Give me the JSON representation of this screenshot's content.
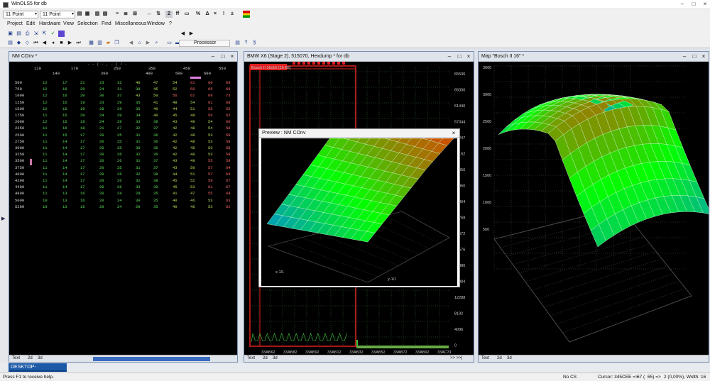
{
  "window": {
    "title": "WinOLS5 for db"
  },
  "toolbar": {
    "font_size_1": "11 Point",
    "font_size_2": "11 Point"
  },
  "menu": {
    "items": [
      "Project",
      "Edit",
      "Hardware",
      "View",
      "Selection",
      "Find",
      "Miscellaneous",
      "Window",
      "?"
    ]
  },
  "toolbar3": {
    "processor_label": "Processor"
  },
  "table_window": {
    "title": "NM COnv *",
    "header_mark": "- - ( - , - ) / -",
    "col_headers_top": [
      "110",
      "170",
      "250",
      "350",
      "450",
      "550"
    ],
    "col_headers_bottom": [
      "140",
      "200",
      "400",
      "500",
      "600"
    ],
    "row_headers": [
      "500",
      "750",
      "1000",
      "1250",
      "1500",
      "1750",
      "2000",
      "2250",
      "2500",
      "2750",
      "3000",
      "3250",
      "3500",
      "3750",
      "4000",
      "4200",
      "4400",
      "4800",
      "5000",
      "5200"
    ],
    "rows": [
      [
        "12",
        "17",
        "21",
        "23",
        "32",
        "40",
        "47",
        "54",
        "61",
        "60",
        "69",
        "72"
      ],
      [
        "12",
        "16",
        "20",
        "24",
        "31",
        "38",
        "45",
        "52",
        "59",
        "65",
        "69",
        "72"
      ],
      [
        "12",
        "16",
        "20",
        "30",
        "37",
        "43",
        "50",
        "56",
        "62",
        "69",
        "73",
        "74"
      ],
      [
        "12",
        "16",
        "19",
        "23",
        "29",
        "35",
        "41",
        "48",
        "54",
        "61",
        "68",
        "72"
      ],
      [
        "12",
        "16",
        "19",
        "28",
        "29",
        "35",
        "40",
        "44",
        "51",
        "55",
        "65",
        "72"
      ],
      [
        "11",
        "15",
        "20",
        "24",
        "29",
        "34",
        "40",
        "45",
        "49",
        "56",
        "62",
        "71"
      ],
      [
        "12",
        "16",
        "19",
        "24",
        "29",
        "33",
        "38",
        "43",
        "49",
        "54",
        "60",
        "69"
      ],
      [
        "11",
        "16",
        "18",
        "21",
        "27",
        "32",
        "37",
        "42",
        "48",
        "54",
        "58",
        "68"
      ],
      [
        "11",
        "15",
        "17",
        "20",
        "25",
        "31",
        "36",
        "42",
        "48",
        "53",
        "59",
        "67"
      ],
      [
        "11",
        "14",
        "17",
        "20",
        "25",
        "31",
        "36",
        "42",
        "48",
        "53",
        "58",
        "67"
      ],
      [
        "11",
        "14",
        "17",
        "20",
        "25",
        "30",
        "36",
        "42",
        "48",
        "53",
        "58",
        "67"
      ],
      [
        "11",
        "14",
        "17",
        "20",
        "26",
        "32",
        "36",
        "42",
        "48",
        "53",
        "58",
        "67"
      ],
      [
        "11",
        "14",
        "17",
        "20",
        "26",
        "31",
        "37",
        "43",
        "49",
        "55",
        "59",
        "67"
      ],
      [
        "11",
        "14",
        "17",
        "20",
        "25",
        "31",
        "37",
        "43",
        "50",
        "57",
        "64",
        "69"
      ],
      [
        "11",
        "14",
        "17",
        "20",
        "26",
        "32",
        "38",
        "44",
        "51",
        "57",
        "64",
        "69"
      ],
      [
        "11",
        "14",
        "17",
        "20",
        "26",
        "32",
        "38",
        "45",
        "52",
        "59",
        "67",
        "69"
      ],
      [
        "11",
        "14",
        "17",
        "20",
        "26",
        "33",
        "39",
        "45",
        "53",
        "61",
        "67",
        "69"
      ],
      [
        "11",
        "13",
        "16",
        "20",
        "24",
        "29",
        "35",
        "41",
        "47",
        "55",
        "64",
        "69"
      ],
      [
        "10",
        "13",
        "16",
        "20",
        "24",
        "30",
        "35",
        "40",
        "46",
        "53",
        "63",
        "69"
      ],
      [
        "10",
        "13",
        "16",
        "20",
        "24",
        "29",
        "35",
        "40",
        "46",
        "53",
        "62",
        "69"
      ]
    ],
    "tabs": [
      "Text",
      "2d",
      "3d"
    ]
  },
  "hex_window": {
    "title": "BMW X6 (Stage 2), 515070, Hexdump * for db",
    "map_label": "Bosch II 16x16 (16 Bit)",
    "right_axis": [
      "65536",
      "65000",
      "61440",
      "57344",
      "53247",
      "49152",
      "45056",
      "40960",
      "36864",
      "32768",
      "28672",
      "24576",
      "20480",
      "16384",
      "12288",
      "8192",
      "4096",
      "0"
    ],
    "address_labels": [
      "33AB62",
      "33AB82",
      "33AB92",
      "33AB12",
      "33AB32",
      "33AB52",
      "33AB72",
      "33AB92",
      "33AC31"
    ],
    "tabs": [
      "Text",
      "2d",
      "3d"
    ],
    "arrows": ">> >>|"
  },
  "preview_window": {
    "title": "Preview : NM COnv",
    "axis_x": "x-1/1",
    "axis_y": "y-1/1"
  },
  "map3d_window": {
    "title": "Map \"Bosch II 16\" *",
    "z_axis": [
      "3600",
      "3000",
      "2500",
      "2000",
      "1500",
      "1000",
      "500"
    ],
    "tabs": [
      "Text",
      "2d",
      "3d"
    ]
  },
  "taskbar": {
    "item": "DESKTOP-5CO06GN_10021"
  },
  "status": {
    "help": "Press F1 to receive help.",
    "cs": "No CS",
    "cursor": "Cursor: 345CEE =>",
    "v1": "67 (",
    "v2": "65) =>",
    "v3": "2 (0,00%), Width: 16"
  }
}
